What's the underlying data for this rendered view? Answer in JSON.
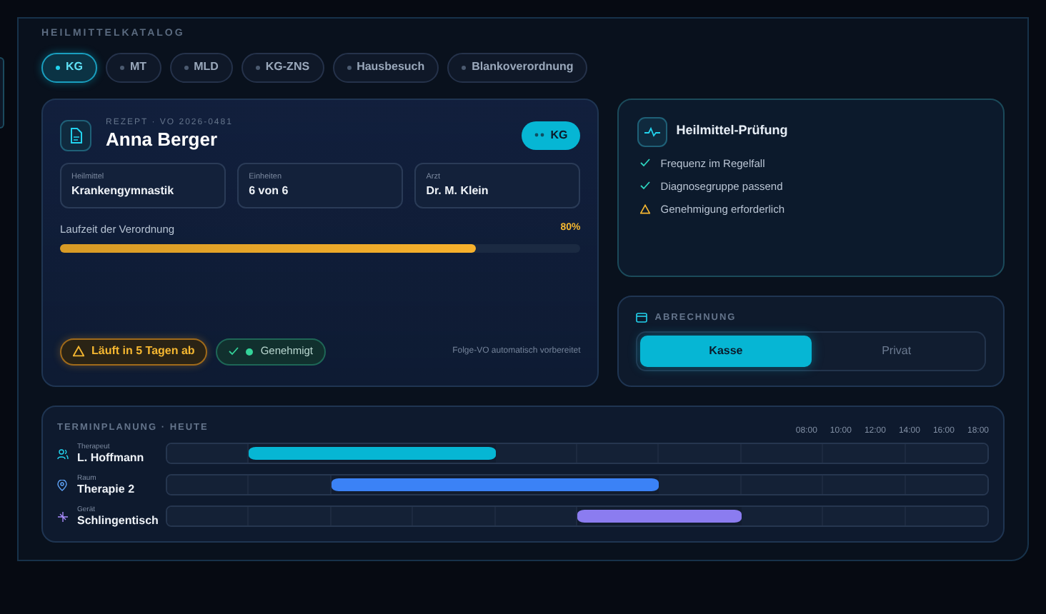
{
  "catalog": {
    "label": "HEILMITTELKATALOG",
    "chips": [
      {
        "label": "KG",
        "selected": true
      },
      {
        "label": "MT",
        "selected": false
      },
      {
        "label": "MLD",
        "selected": false
      },
      {
        "label": "KG-ZNS",
        "selected": false
      },
      {
        "label": "Hausbesuch",
        "selected": false
      },
      {
        "label": "Blankoverordnung",
        "selected": false
      }
    ]
  },
  "prescription": {
    "ref": "REZEPT · VO 2026-0481",
    "patient": "Anna Berger",
    "badge": "KG",
    "fields": [
      {
        "label": "Heilmittel",
        "value": "Krankengymnastik"
      },
      {
        "label": "Einheiten",
        "value": "6 von 6"
      },
      {
        "label": "Arzt",
        "value": "Dr. M. Klein"
      }
    ],
    "progress": {
      "label": "Laufzeit der Verordnung",
      "reading": "80%",
      "level": 0.8
    },
    "warning": "Läuft in 5 Tagen ab",
    "status": "Genehmigt",
    "note": "Folge-VO automatisch vorbereitet"
  },
  "check": {
    "title": "Heilmittel-Prüfung",
    "items": [
      {
        "kind": "ok",
        "text": "Frequenz im Regelfall"
      },
      {
        "kind": "ok",
        "text": "Diagnosegruppe passend"
      },
      {
        "kind": "warn",
        "text": "Genehmigung erforderlich"
      }
    ]
  },
  "billing": {
    "label": "ABRECHNUNG",
    "options": [
      {
        "label": "Kasse",
        "selected": true
      },
      {
        "label": "Privat",
        "selected": false
      }
    ]
  },
  "schedule": {
    "title": "TERMINPLANUNG · HEUTE",
    "times": [
      "08:00",
      "10:00",
      "12:00",
      "14:00",
      "16:00",
      "18:00"
    ],
    "rows": [
      {
        "kind": "person",
        "role": "Therapeut",
        "name": "L. Hoffmann",
        "color": "#06b6d4",
        "slots": [
          {
            "booked": false
          },
          {
            "booked": true
          },
          {
            "booked": true
          },
          {
            "booked": true
          },
          {
            "booked": false
          },
          {
            "booked": false
          },
          {
            "booked": false
          },
          {
            "booked": false
          },
          {
            "booked": false
          },
          {
            "booked": false
          }
        ]
      },
      {
        "kind": "room",
        "role": "Raum",
        "name": "Therapie 2",
        "color": "#3b82f6",
        "slots": [
          {
            "booked": false
          },
          {
            "booked": false
          },
          {
            "booked": true
          },
          {
            "booked": true
          },
          {
            "booked": true
          },
          {
            "booked": true
          },
          {
            "booked": false
          },
          {
            "booked": false
          },
          {
            "booked": false
          },
          {
            "booked": false
          }
        ]
      },
      {
        "kind": "device",
        "role": "Gerät",
        "name": "Schlingentisch",
        "color": "#8b7cf0",
        "slots": [
          {
            "booked": false
          },
          {
            "booked": false
          },
          {
            "booked": false
          },
          {
            "booked": false
          },
          {
            "booked": false
          },
          {
            "booked": true
          },
          {
            "booked": true
          },
          {
            "booked": false
          },
          {
            "booked": false
          },
          {
            "booked": false
          }
        ]
      }
    ]
  }
}
